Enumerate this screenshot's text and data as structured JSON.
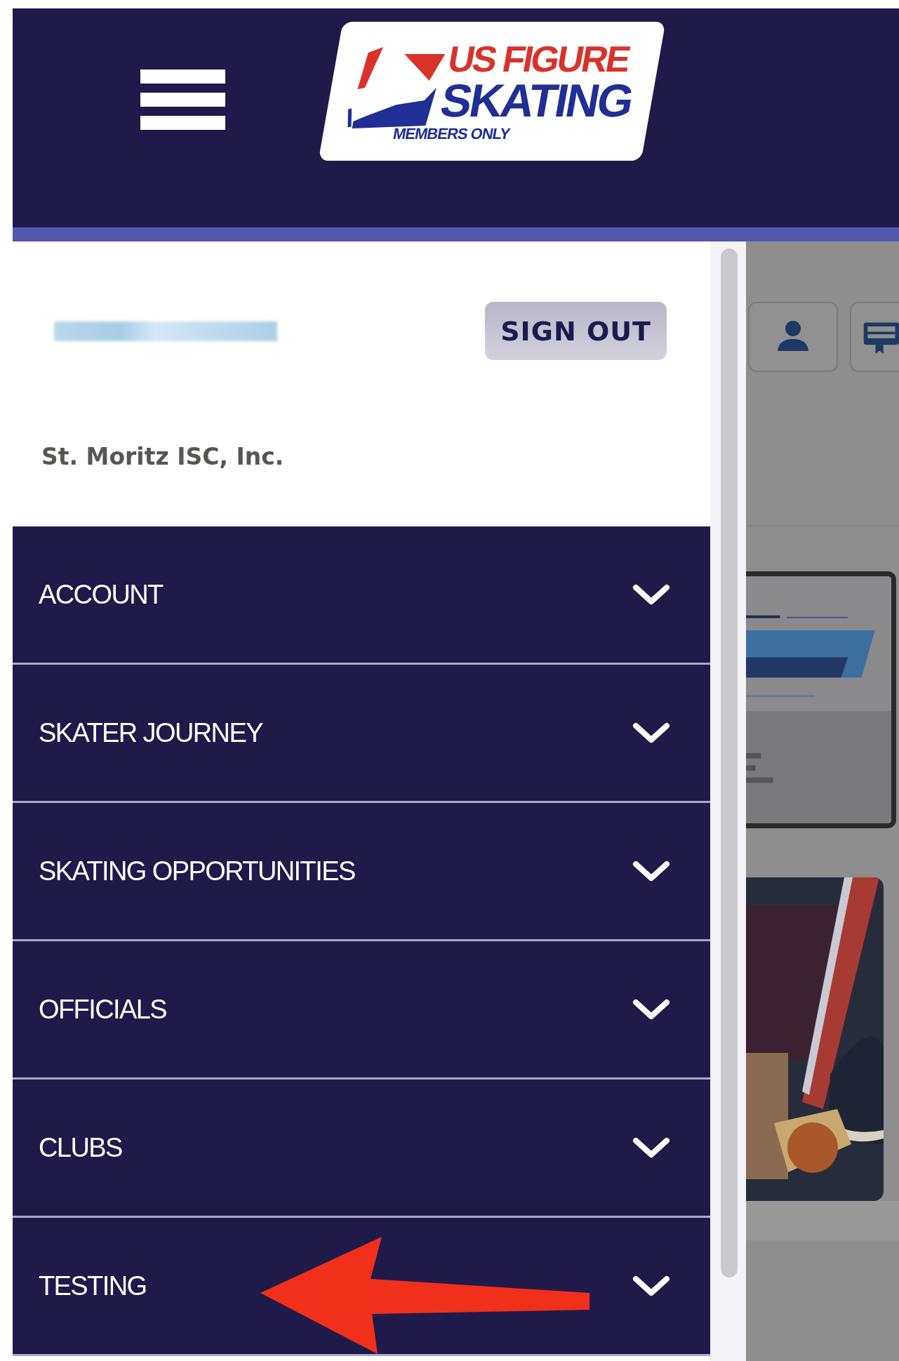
{
  "header": {
    "logo": {
      "line_1": "US FIGURE",
      "line_2": "SKATING",
      "tagline": "MEMBERS ONLY"
    }
  },
  "drawer": {
    "sign_out_button": "SIGN OUT",
    "organization": "St. Moritz ISC, Inc.",
    "menu": [
      {
        "label": "ACCOUNT",
        "expanded": false
      },
      {
        "label": "SKATER JOURNEY",
        "expanded": false
      },
      {
        "label": "SKATING OPPORTUNITIES",
        "expanded": false
      },
      {
        "label": "OFFICIALS",
        "expanded": false
      },
      {
        "label": "CLUBS",
        "expanded": false
      },
      {
        "label": "TESTING",
        "expanded": false
      }
    ]
  }
}
